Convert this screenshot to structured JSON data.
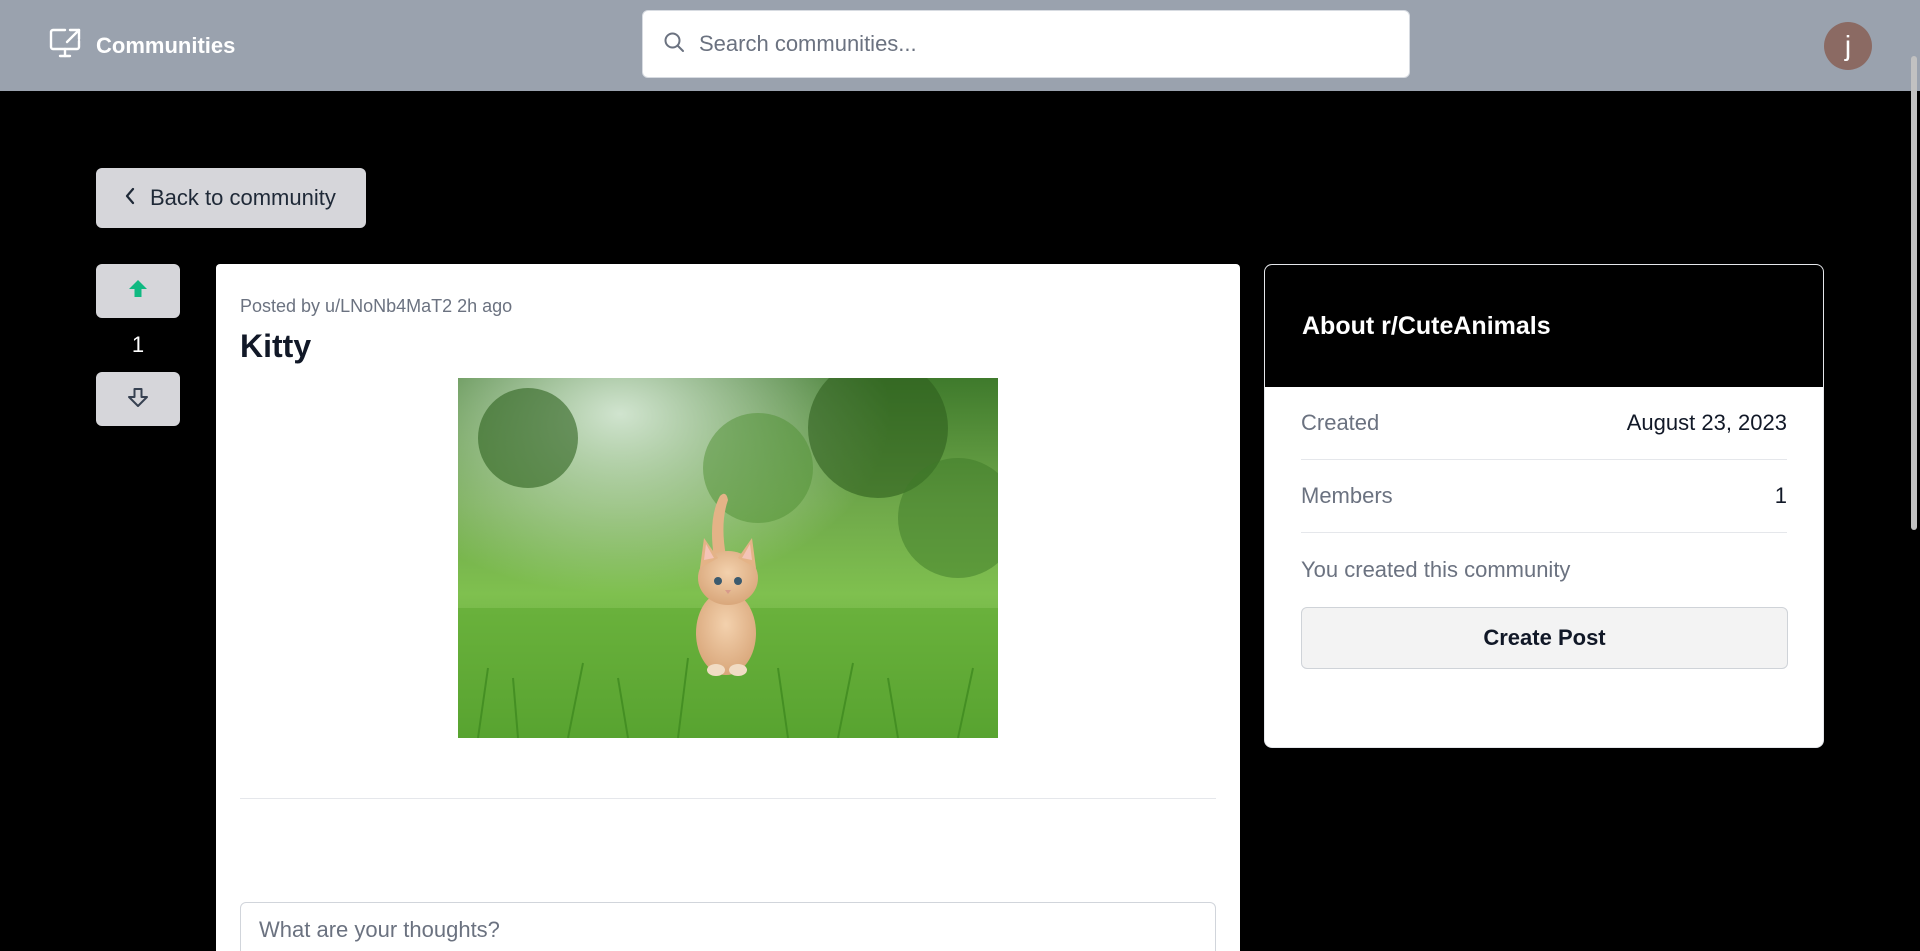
{
  "header": {
    "brand_label": "Communities",
    "search_placeholder": "Search communities...",
    "avatar_initial": "j"
  },
  "nav": {
    "back_label": "Back to community"
  },
  "post": {
    "vote_count": "1",
    "meta": "Posted by u/LNoNb4MaT2 2h ago",
    "title": "Kitty",
    "comment_placeholder": "What are your thoughts?"
  },
  "about": {
    "title": "About r/CuteAnimals",
    "rows": [
      {
        "label": "Created",
        "value": "August 23, 2023"
      },
      {
        "label": "Members",
        "value": "1"
      }
    ],
    "note": "You created this community",
    "create_post_label": "Create Post"
  },
  "colors": {
    "topbar": "#9aa2ae",
    "upvote_active": "#10b981",
    "vote_button_bg": "#d6d6da",
    "page_bg": "#000000"
  },
  "icons": {
    "brand": "monitor-share-icon",
    "search": "search-icon",
    "back": "chevron-left-icon",
    "upvote": "arrow-up-icon",
    "downvote": "arrow-down-icon"
  }
}
